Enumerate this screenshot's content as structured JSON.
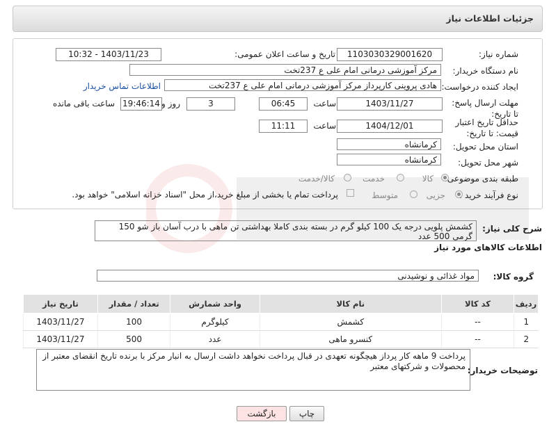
{
  "header": {
    "title": "جزئیات اطلاعات نیاز"
  },
  "form": {
    "need_number_label": "شماره نیاز:",
    "need_number": "1103030329001620",
    "announce_label": "تاریخ و ساعت اعلان عمومی:",
    "announce_value": "1403/11/23 - 10:32",
    "buyer_org_label": "نام دستگاه خریدار:",
    "buyer_org": "مرکز آموزشی درمانی امام علی ع 237تخت",
    "creator_label": "ایجاد کننده درخواست:",
    "creator": "هادی پروینی کارپرداز  مرکز آموزشی درمانی امام علی ع 237تخت",
    "contact_link": "اطلاعات تماس خریدار",
    "deadline_label": "مهلت ارسال پاسخ: تا تاریخ:",
    "deadline_date": "1403/11/27",
    "time_label": "ساعت",
    "deadline_time": "06:45",
    "days_value": "3",
    "days_label": "روز و",
    "remaining_time": "19:46:14",
    "remaining_label": "ساعت باقی مانده",
    "validity_label": "حداقل تاریخ اعتبار قیمت: تا تاریخ:",
    "validity_date": "1404/12/01",
    "validity_time": "11:11",
    "province_label": "استان محل تحویل:",
    "province": "کرمانشاه",
    "city_label": "شهر محل تحویل:",
    "city": "کرمانشاه",
    "category_label": "طبقه بندی موضوعی:",
    "category_options": [
      "کالا",
      "خدمت",
      "کالا/خدمت"
    ],
    "process_label": "نوع فرآیند خرید :",
    "process_options": [
      "جزیی",
      "متوسط"
    ],
    "payment_note": "پرداخت تمام یا بخشی از مبلغ خرید،از محل \"اسناد خزانه اسلامی\" خواهد بود."
  },
  "summary": {
    "label": "شرح کلی نیاز:",
    "text": "کشمش پلویی درجه یک 100 کیلو گرم  در بسته بندی کاملا بهداشتی   تن ماهی  با درب  آسان باز شو 150 گرمی  500 عدد"
  },
  "goods": {
    "section_title": "اطلاعات کالاهای مورد نیاز",
    "group_label": "گروه کالا:",
    "group_value": "مواد غذائی و نوشیدنی",
    "columns": [
      "ردیف",
      "کد کالا",
      "نام کالا",
      "واحد شمارش",
      "تعداد / مقدار",
      "تاریخ نیاز"
    ],
    "rows": [
      {
        "row": "1",
        "code": "--",
        "name": "کشمش",
        "unit": "کیلوگرم",
        "qty": "100",
        "date": "1403/11/27"
      },
      {
        "row": "2",
        "code": "--",
        "name": "کنسرو ماهی",
        "unit": "عدد",
        "qty": "500",
        "date": "1403/11/27"
      }
    ]
  },
  "buyer_notes": {
    "label": "توضیحات خریدار:",
    "text": "پرداخت 9 ماهه کار پرداز هیچگونه تعهدی در قبال پرداخت نخواهد داشت ارسال به انبار مرکز با برنده  تاریخ انقضای معتبر از محصولات و شرکتهای معتبر"
  },
  "buttons": {
    "print": "چاپ",
    "back": "بازگشت"
  },
  "colors": {
    "link": "#1a4fa0",
    "back_button_bg": "#fde3e3"
  }
}
